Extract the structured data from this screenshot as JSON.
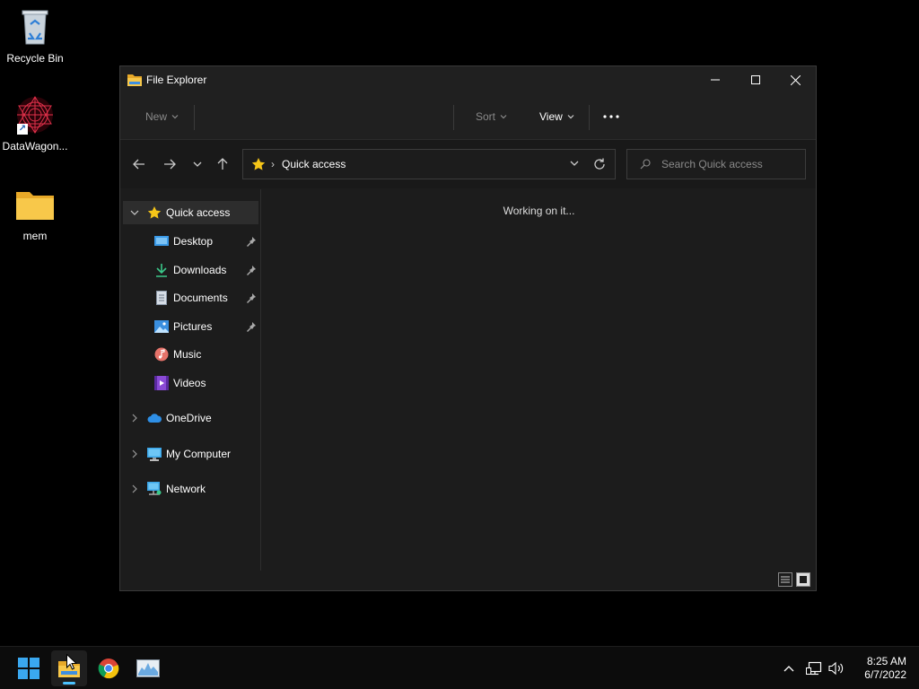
{
  "desktop": {
    "icons": [
      {
        "label": "Recycle Bin"
      },
      {
        "label": "DataWagon..."
      },
      {
        "label": "mem"
      }
    ]
  },
  "window": {
    "title": "File Explorer",
    "commandbar": {
      "new_label": "New",
      "sort_label": "Sort",
      "view_label": "View"
    },
    "address": {
      "path": "Quick access",
      "search_placeholder": "Search Quick access"
    },
    "navpane": {
      "quick_access": "Quick access",
      "pinned": [
        "Desktop",
        "Downloads",
        "Documents",
        "Pictures"
      ],
      "folders": [
        "Music",
        "Videos"
      ],
      "onedrive": "OneDrive",
      "my_computer": "My Computer",
      "network": "Network"
    },
    "content": {
      "status": "Working on it..."
    }
  },
  "taskbar": {
    "time": "8:25 AM",
    "date": "6/7/2022"
  },
  "colors": {
    "accent": "#4cc2ff",
    "folder": "#f8c84a",
    "window_bg": "#1c1c1c",
    "selection": "#2d2d2d"
  }
}
